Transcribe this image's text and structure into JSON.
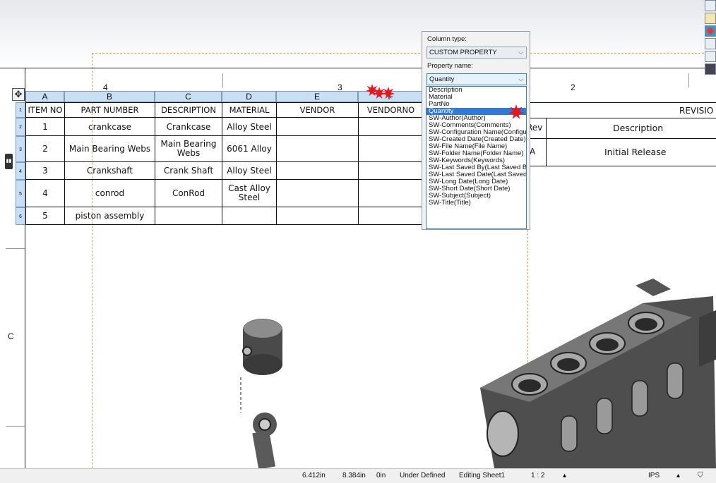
{
  "sheet": {
    "zone_labels": {
      "top": [
        "4",
        "3",
        "2"
      ],
      "left": [
        "C"
      ]
    }
  },
  "bom_table": {
    "column_letters": [
      "A",
      "B",
      "C",
      "D",
      "E",
      "F"
    ],
    "row_numbers": [
      "1",
      "2",
      "3",
      "4",
      "5",
      "6"
    ],
    "headers": [
      "ITEM NO",
      "PART NUMBER",
      "DESCRIPTION",
      "MATERIAL",
      "VENDOR",
      "VENDORNO"
    ],
    "rows": [
      [
        "1",
        "crankcase",
        "Crankcase",
        "Alloy Steel",
        "",
        ""
      ],
      [
        "2",
        "Main Bearing Webs",
        "Main Bearing Webs",
        "6061 Alloy",
        "",
        ""
      ],
      [
        "3",
        "Crankshaft",
        "Crank Shaft",
        "Alloy Steel",
        "",
        ""
      ],
      [
        "4",
        "conrod",
        "ConRod",
        "Cast Alloy Steel",
        "",
        ""
      ],
      [
        "5",
        "piston assembly",
        "",
        "",
        "",
        ""
      ]
    ]
  },
  "revision_table": {
    "title": "REVISIO",
    "headers": [
      "Rev",
      "Description"
    ],
    "rows": [
      [
        "A",
        "Initial Release"
      ]
    ]
  },
  "column_popup": {
    "column_type_label": "Column type:",
    "column_type_value": "CUSTOM PROPERTY",
    "property_name_label": "Property name:",
    "property_name_value": "Quantity",
    "options": [
      "Description",
      "Material",
      "PartNo",
      "Quantity",
      "SW-Author(Author)",
      "SW-Comments(Comments)",
      "SW-Configuration Name(Configuration Name)",
      "SW-Created Date(Created Date)",
      "SW-File Name(File Name)",
      "SW-Folder Name(Folder Name)",
      "SW-Keywords(Keywords)",
      "SW-Last Saved By(Last Saved By)",
      "SW-Last Saved Date(Last Saved Date)",
      "SW-Long Date(Long Date)",
      "SW-Short Date(Short Date)",
      "SW-Subject(Subject)",
      "SW-Title(Title)"
    ],
    "selected_option": "Quantity"
  },
  "status_bar": {
    "x_coord": "6.412in",
    "y_coord": "8.384in",
    "z_coord": "0in",
    "state": "Under Defined",
    "mode": "Editing Sheet1",
    "scale": "1 : 2",
    "units": "IPS"
  },
  "icons": [
    "move-handle-icon",
    "burst-marker-icon",
    "chevron-down-icon",
    "folder-icon",
    "appearance-icon"
  ],
  "colors": {
    "header_blue": "#c9dff3",
    "selection_blue": "#3079d6",
    "burst_red": "#e8141c",
    "dash_orange": "#e0a050"
  }
}
